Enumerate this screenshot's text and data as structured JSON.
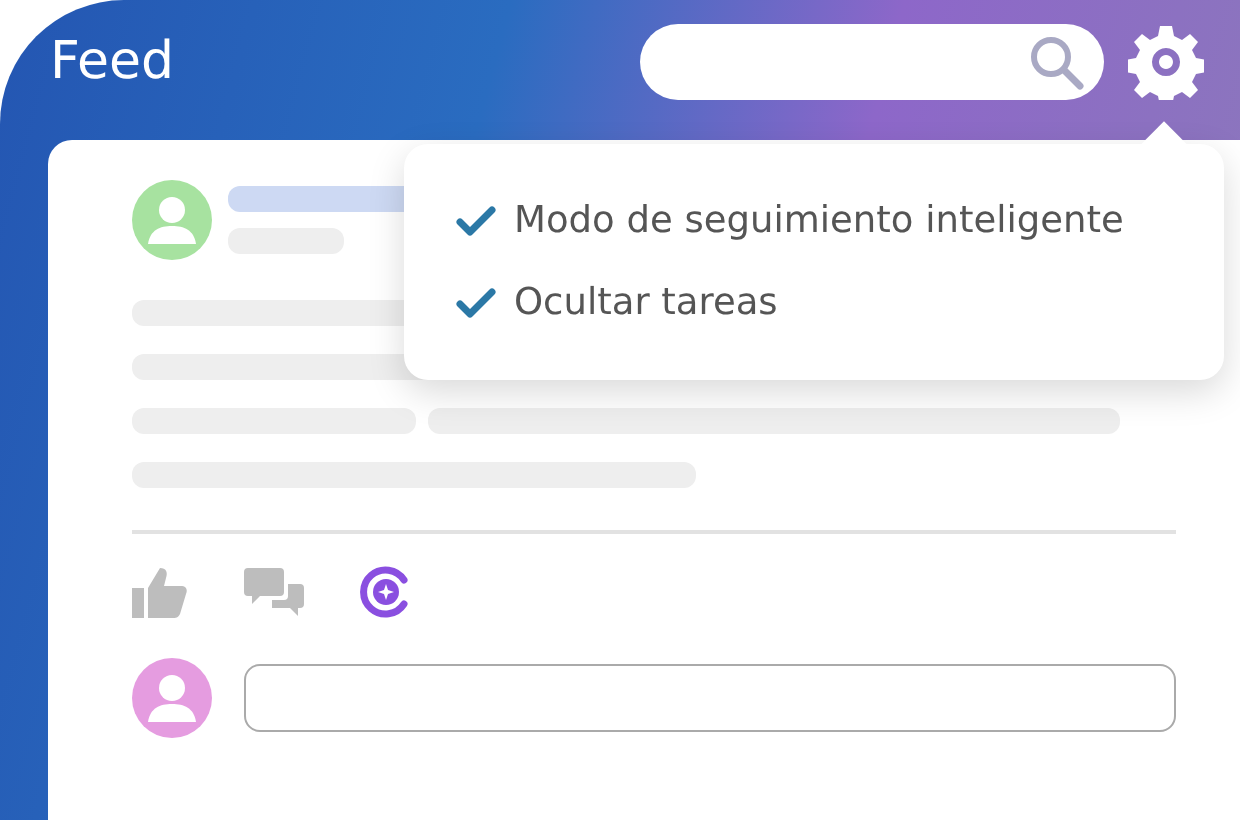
{
  "header": {
    "title": "Feed"
  },
  "settings_menu": {
    "items": [
      {
        "label": "Modo de seguimiento inteligente",
        "checked": true
      },
      {
        "label": "Ocultar tareas",
        "checked": true
      }
    ]
  }
}
